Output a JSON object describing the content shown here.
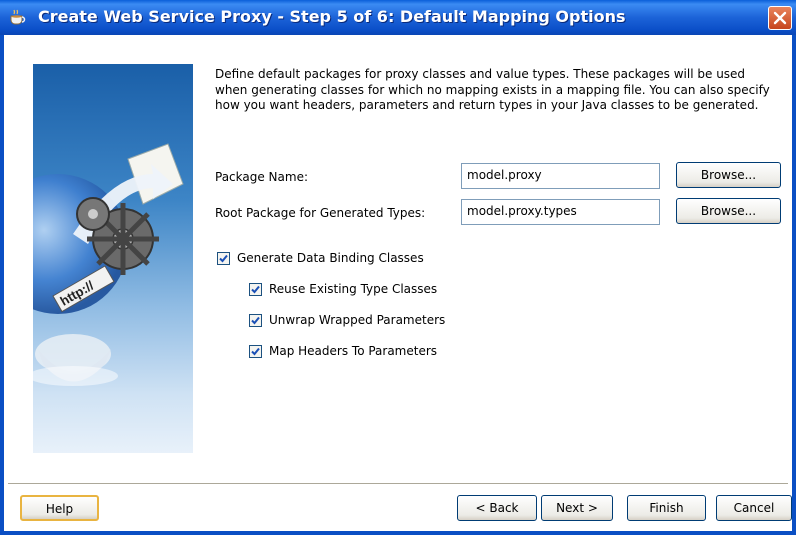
{
  "window": {
    "title": "Create Web Service Proxy - Step 5 of 6: Default Mapping Options"
  },
  "description": "Define default packages for proxy classes and value types. These packages will be used when generating classes for which no mapping exists in a mapping file. You can also specify how you want headers, parameters and return types in your Java classes to be generated.",
  "form": {
    "package_name_label": "Package Name:",
    "package_name_value": "model.proxy",
    "root_package_label": "Root Package for Generated Types:",
    "root_package_value": "model.proxy.types",
    "browse_label": "Browse..."
  },
  "options": {
    "generate_data_binding": {
      "label": "Generate Data Binding Classes",
      "checked": true
    },
    "reuse_existing": {
      "label": "Reuse Existing Type Classes",
      "checked": true
    },
    "unwrap_wrapped": {
      "label": "Unwrap Wrapped Parameters",
      "checked": true
    },
    "map_headers": {
      "label": "Map Headers To Parameters",
      "checked": true
    }
  },
  "footer": {
    "help": "Help",
    "back": "< Back",
    "next": "Next >",
    "finish": "Finish",
    "cancel": "Cancel"
  },
  "side_image_text": "http://",
  "colors": {
    "titlebar": "#0b4fc8",
    "check": "#1a4fb5"
  },
  "icons": [
    "coffee-cup-icon",
    "close-icon",
    "checkmark-icon"
  ]
}
